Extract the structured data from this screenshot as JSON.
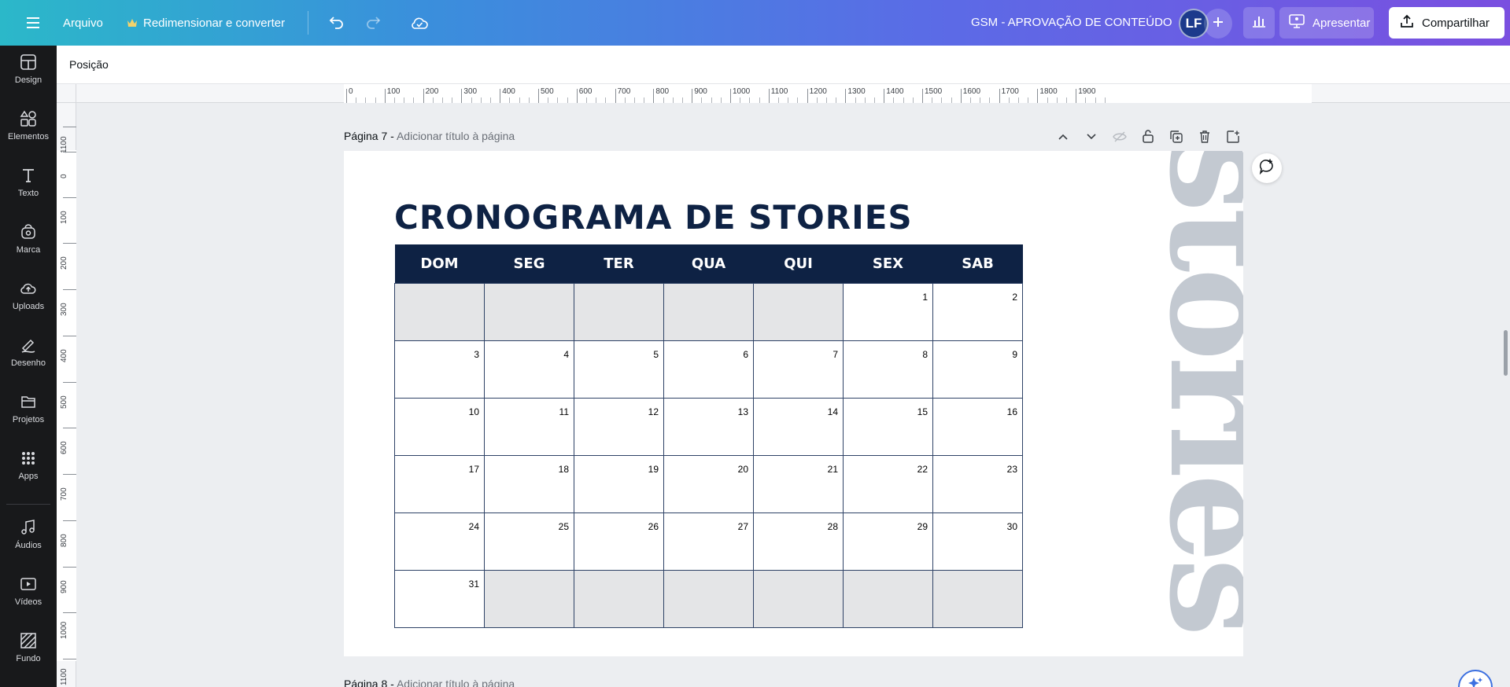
{
  "topbar": {
    "menu_icon": "hamburger-icon",
    "file_label": "Arquivo",
    "resize_label": "Redimensionar e converter",
    "doc_title": "GSM - APROVAÇÃO DE CONTEÚDO",
    "avatar_initials": "LF",
    "present_label": "Apresentar",
    "share_label": "Compartilhar",
    "accent_colors": [
      "#2bb8c9",
      "#3a8fdc",
      "#7a4fe0"
    ]
  },
  "sidebar": {
    "items": [
      {
        "label": "Design",
        "icon": "layout-icon"
      },
      {
        "label": "Elementos",
        "icon": "shapes-icon"
      },
      {
        "label": "Texto",
        "icon": "text-icon"
      },
      {
        "label": "Marca",
        "icon": "brand-icon"
      },
      {
        "label": "Uploads",
        "icon": "cloud-upload-icon"
      },
      {
        "label": "Desenho",
        "icon": "pen-icon"
      },
      {
        "label": "Projetos",
        "icon": "folder-icon"
      },
      {
        "label": "Apps",
        "icon": "grid-icon"
      },
      {
        "label": "Áudios",
        "icon": "music-icon"
      },
      {
        "label": "Vídeos",
        "icon": "video-icon"
      },
      {
        "label": "Fundo",
        "icon": "pattern-icon"
      }
    ]
  },
  "context_bar": {
    "position_label": "Posição"
  },
  "rulers": {
    "horizontal": [
      "0",
      "100",
      "200",
      "300",
      "400",
      "500",
      "600",
      "700",
      "800",
      "900",
      "1000",
      "1100",
      "1200",
      "1300",
      "1400",
      "1500",
      "1600",
      "1700",
      "1800",
      "1900"
    ],
    "vertical": [
      "1100",
      "0",
      "100",
      "200",
      "300",
      "400",
      "500",
      "600",
      "700",
      "800",
      "900",
      "1000",
      "1100"
    ]
  },
  "pages": {
    "current": {
      "number_label": "Página 7 -",
      "title_placeholder": "Adicionar título à página"
    },
    "next": {
      "number_label": "Página 8 -",
      "title_placeholder": "Adicionar título à página"
    }
  },
  "design": {
    "title": "CRONOGRAMA DE STORIES",
    "decorative_word": "stories",
    "weekdays": [
      "DOM",
      "SEG",
      "TER",
      "QUA",
      "QUI",
      "SEX",
      "SAB"
    ],
    "weeks": [
      [
        "",
        "",
        "",
        "",
        "",
        "1",
        "2"
      ],
      [
        "3",
        "4",
        "5",
        "6",
        "7",
        "8",
        "9"
      ],
      [
        "10",
        "11",
        "12",
        "13",
        "14",
        "15",
        "16"
      ],
      [
        "17",
        "18",
        "19",
        "20",
        "21",
        "22",
        "23"
      ],
      [
        "24",
        "25",
        "26",
        "27",
        "28",
        "29",
        "30"
      ],
      [
        "31",
        "",
        "",
        "",
        "",
        "",
        ""
      ]
    ],
    "header_color": "#0e2244",
    "empty_cell_color": "#e4e5e7",
    "decorative_color": "#c3c9d1"
  }
}
